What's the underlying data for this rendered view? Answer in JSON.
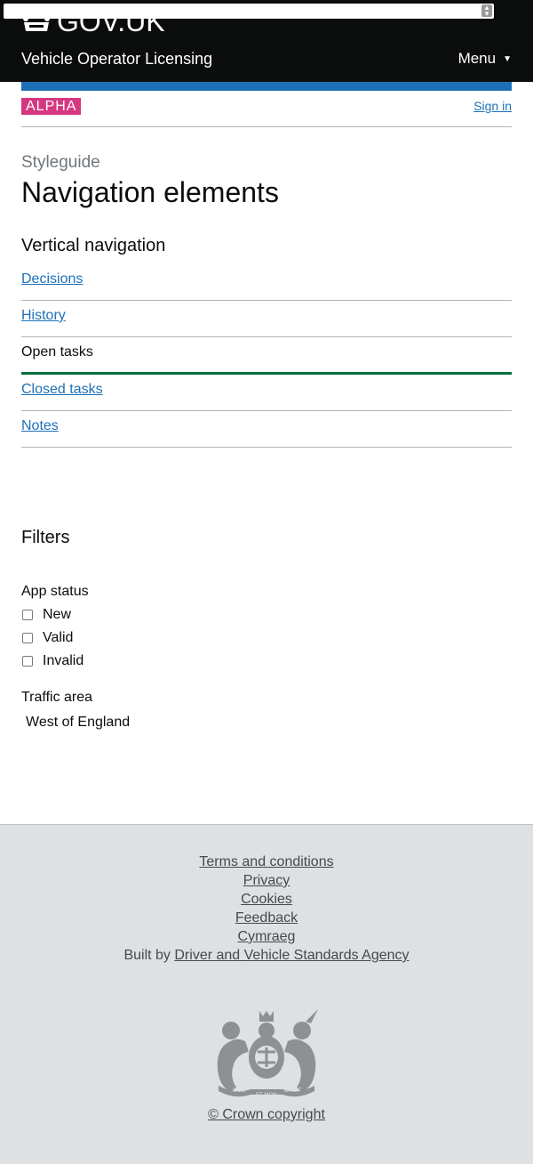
{
  "header": {
    "logo_text": "GOV.UK",
    "service_name": "Vehicle Operator Licensing",
    "menu_label": "Menu"
  },
  "phase": {
    "tag": "ALPHA",
    "sign_in": "Sign in"
  },
  "page": {
    "caption": "Styleguide",
    "title": "Navigation elements"
  },
  "vertical_nav": {
    "heading": "Vertical navigation",
    "items": [
      {
        "label": "Decisions",
        "active": false
      },
      {
        "label": "History",
        "active": false
      },
      {
        "label": "Open tasks",
        "active": true
      },
      {
        "label": "Closed tasks",
        "active": false
      },
      {
        "label": "Notes",
        "active": false
      }
    ]
  },
  "filters": {
    "heading": "Filters",
    "app_status": {
      "label": "App status",
      "options": [
        {
          "label": "New",
          "checked": false
        },
        {
          "label": "Valid",
          "checked": false
        },
        {
          "label": "Invalid",
          "checked": false
        }
      ]
    },
    "traffic_area": {
      "label": "Traffic area",
      "value": "West of England"
    }
  },
  "footer": {
    "links": [
      "Terms and conditions",
      "Privacy",
      "Cookies",
      "Feedback",
      "Cymraeg"
    ],
    "built_by_prefix": "Built by",
    "built_by_link": "Driver and Vehicle Standards Agency",
    "copyright": "© Crown copyright",
    "crest_motto_1": "DIEU",
    "crest_motto_2": "ET MON",
    "crest_motto_3": "DROIT"
  },
  "colors": {
    "header_bg": "#0b0c0c",
    "brand_blue": "#1d70b8",
    "phase_pink": "#d53880",
    "active_green": "#00703c",
    "footer_bg": "#dee0e2"
  },
  "icons": [
    "crown-icon",
    "triangle-down-icon",
    "royal-crest-icon"
  ]
}
